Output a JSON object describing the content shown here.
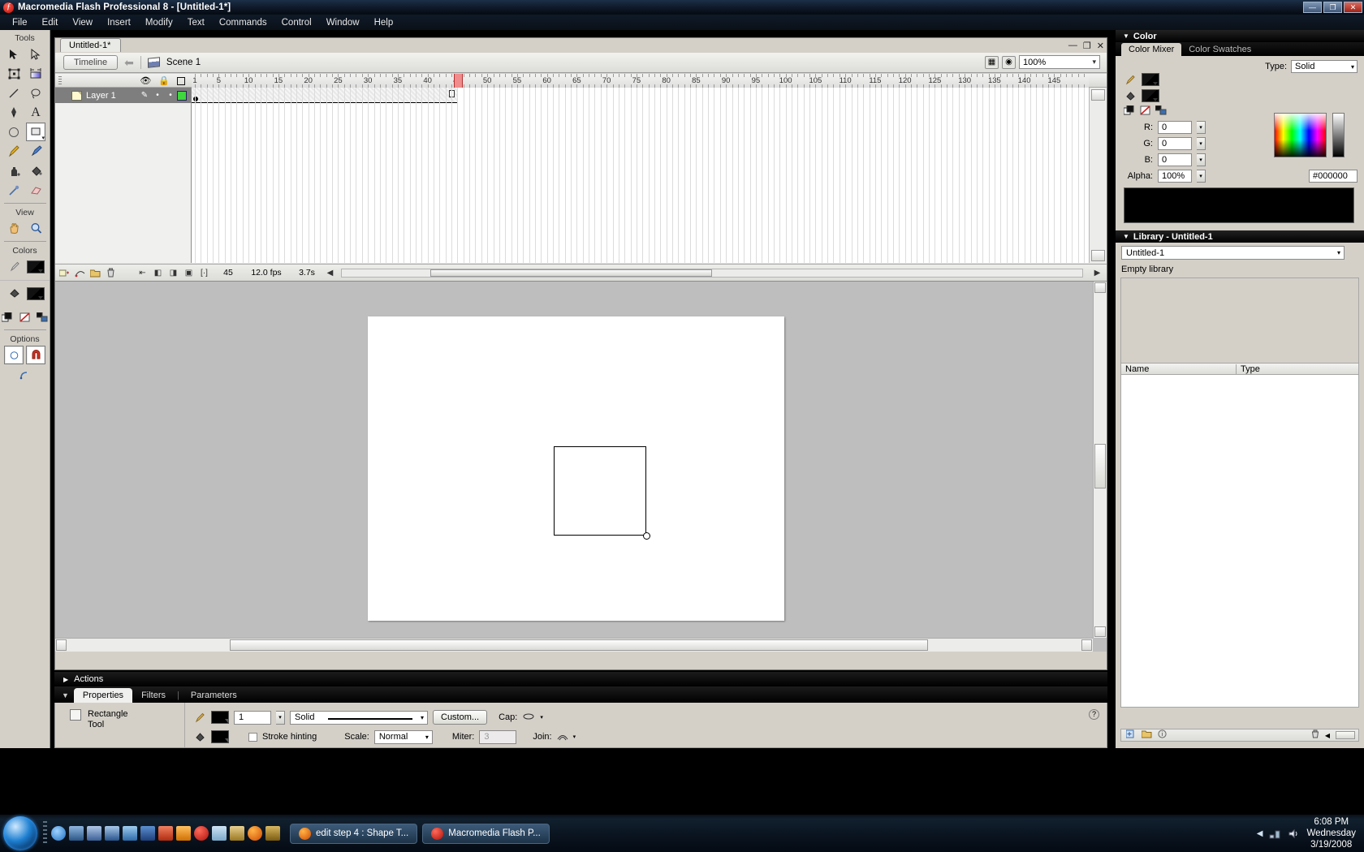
{
  "titlebar": {
    "title": "Macromedia Flash Professional 8 - [Untitled-1*]",
    "minimize": "—",
    "maximize": "❐",
    "close": "✕"
  },
  "menubar": {
    "items": [
      "File",
      "Edit",
      "View",
      "Insert",
      "Modify",
      "Text",
      "Commands",
      "Control",
      "Window",
      "Help"
    ]
  },
  "tools": {
    "sections": {
      "tools": "Tools",
      "view": "View",
      "colors": "Colors",
      "options": "Options"
    },
    "items": [
      {
        "name": "selection-tool",
        "label": "Selection"
      },
      {
        "name": "subselection-tool",
        "label": "Subselection"
      },
      {
        "name": "free-transform-tool",
        "label": "Free Transform"
      },
      {
        "name": "gradient-transform-tool",
        "label": "Gradient Transform"
      },
      {
        "name": "line-tool",
        "label": "Line"
      },
      {
        "name": "lasso-tool",
        "label": "Lasso"
      },
      {
        "name": "pen-tool",
        "label": "Pen"
      },
      {
        "name": "text-tool",
        "label": "Text"
      },
      {
        "name": "oval-tool",
        "label": "Oval"
      },
      {
        "name": "rectangle-tool",
        "label": "Rectangle"
      },
      {
        "name": "pencil-tool",
        "label": "Pencil"
      },
      {
        "name": "brush-tool",
        "label": "Brush"
      },
      {
        "name": "ink-bottle-tool",
        "label": "Ink Bottle"
      },
      {
        "name": "paint-bucket-tool",
        "label": "Paint Bucket"
      },
      {
        "name": "eyedropper-tool",
        "label": "Eyedropper"
      },
      {
        "name": "eraser-tool",
        "label": "Eraser"
      }
    ],
    "view_items": [
      {
        "name": "hand-tool",
        "label": "Hand"
      },
      {
        "name": "zoom-tool",
        "label": "Zoom"
      }
    ],
    "option_items": [
      {
        "name": "object-drawing-option",
        "label": "Object Drawing"
      },
      {
        "name": "snap-to-objects-option",
        "label": "Snap to Objects"
      },
      {
        "name": "round-rectangle-radius-option",
        "label": "Set Corner Radius"
      }
    ]
  },
  "document": {
    "tab_label": "Untitled-1*",
    "window_buttons": {
      "minimize": "—",
      "restore": "❐",
      "close": "✕"
    },
    "timeline_button": "Timeline",
    "scene_label": "Scene 1",
    "zoom_value": "100%"
  },
  "timeline": {
    "ruler_labels": [
      "1",
      "5",
      "10",
      "15",
      "20",
      "25",
      "30",
      "35",
      "40",
      "45",
      "50",
      "55",
      "60",
      "65",
      "70",
      "75",
      "80",
      "85",
      "90",
      "95",
      "100",
      "105",
      "110",
      "115",
      "120",
      "125",
      "130",
      "135",
      "140",
      "145"
    ],
    "playhead_frame": "45",
    "layers": [
      {
        "name": "Layer 1",
        "pencil": "✎",
        "eye": "•",
        "lock": "•",
        "outline_color": "#3fd63f"
      }
    ],
    "header_icons": {
      "eye": "eye-icon",
      "lock": "lock-icon",
      "outline": "outline-icon"
    },
    "status": {
      "current_frame": "45",
      "fps": "12.0 fps",
      "elapsed": "3.7s",
      "buttons": [
        "insert-layer",
        "add-motion-guide",
        "insert-folder",
        "delete-layer",
        "center-frame",
        "onion-skin",
        "onion-skin-outlines",
        "edit-multiple-frames",
        "modify-onion-markers"
      ]
    }
  },
  "stage": {
    "shape_name": "rectangle-shape"
  },
  "actions_panel": {
    "label": "Actions",
    "collapsed_caret": "▶"
  },
  "properties_panel": {
    "caret": "▼",
    "tabs": [
      {
        "label": "Properties",
        "active": true
      },
      {
        "label": "Filters",
        "active": false
      },
      {
        "label": "Parameters",
        "active": false
      }
    ],
    "divider": "|",
    "tool_name_line1": "Rectangle",
    "tool_name_line2": "Tool",
    "stroke_width": "1",
    "stroke_style": "Solid",
    "custom_button": "Custom...",
    "cap_label": "Cap:",
    "stroke_hinting_label": "Stroke hinting",
    "scale_label": "Scale:",
    "scale_value": "Normal",
    "miter_label": "Miter:",
    "miter_value": "3",
    "join_label": "Join:",
    "help_icon": "?"
  },
  "color_panel": {
    "title": "Color",
    "tabs": [
      {
        "label": "Color Mixer",
        "active": true
      },
      {
        "label": "Color Swatches",
        "active": false
      }
    ],
    "type_label": "Type:",
    "type_value": "Solid",
    "fields": [
      {
        "label": "R:",
        "value": "0"
      },
      {
        "label": "G:",
        "value": "0"
      },
      {
        "label": "B:",
        "value": "0"
      },
      {
        "label": "Alpha:",
        "value": "100%"
      }
    ],
    "hex_value": "#000000",
    "preview_color": "#000000",
    "stroke_color": "#000000",
    "fill_color": "#000000"
  },
  "library_panel": {
    "title": "Library - Untitled-1",
    "selector_value": "Untitled-1",
    "item_count": "Empty library",
    "columns": [
      "Name",
      "Type"
    ],
    "footer_buttons": [
      "new-symbol",
      "new-folder",
      "properties",
      "delete"
    ]
  },
  "taskbar": {
    "start_label": "Start",
    "quicklaunch": [
      {
        "name": "internet-explorer-icon",
        "color": "#2f7ed8"
      },
      {
        "name": "show-desktop-icon",
        "color": "#4a6fa5"
      },
      {
        "name": "media-player-icon",
        "color": "#5a7fc0"
      },
      {
        "name": "window-icon",
        "color": "#3d6fb5"
      },
      {
        "name": "snipping-icon",
        "color": "#4f8fd0"
      },
      {
        "name": "word-icon",
        "color": "#2b5797"
      },
      {
        "name": "powerpoint-icon",
        "color": "#d24726"
      },
      {
        "name": "media-play-icon",
        "color": "#ff8c00"
      },
      {
        "name": "flash-icon",
        "color": "#c1110b"
      },
      {
        "name": "recycle-icon",
        "color": "#8bb6d8"
      },
      {
        "name": "paint-icon",
        "color": "#c8a020"
      },
      {
        "name": "firefox-icon",
        "color": "#e66000"
      },
      {
        "name": "film-icon",
        "color": "#b08030"
      }
    ],
    "tasks": [
      {
        "label": "edit step 4 : Shape T...",
        "icon": "firefox-icon",
        "color": "#e66000"
      },
      {
        "label": "Macromedia Flash P...",
        "icon": "flash-icon",
        "color": "#c1110b"
      }
    ],
    "tray_icons": [
      "show-hidden-icon",
      "network-icon",
      "volume-icon"
    ],
    "clock_time": "6:08 PM",
    "clock_day": "Wednesday",
    "clock_date": "3/19/2008"
  }
}
